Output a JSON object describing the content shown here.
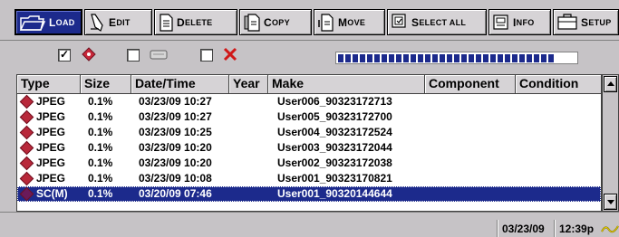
{
  "toolbar": {
    "buttons": [
      {
        "label_big": "L",
        "label": "OAD"
      },
      {
        "label_big": "E",
        "label": "DIT"
      },
      {
        "label_big": "D",
        "label": "ELETE"
      },
      {
        "label_big": "C",
        "label": "OPY"
      },
      {
        "label_big": "M",
        "label": "OVE"
      },
      {
        "label_big": "S",
        "label": "ELECT ALL"
      },
      {
        "label_big": "I",
        "label": "NFO"
      },
      {
        "label_big": "S",
        "label": "ETUP"
      }
    ]
  },
  "filters": {
    "checks": [
      "✓",
      "",
      ""
    ],
    "progress_segments": 30
  },
  "table": {
    "columns": [
      "Type",
      "Size",
      "Date/Time",
      "Year",
      "Make",
      "Component",
      "Condition"
    ],
    "rows": [
      {
        "type": "JPEG",
        "size": "0.1%",
        "datetime": "03/23/09 10:27",
        "year": "",
        "make": "User006_90323172713",
        "component": "",
        "condition": ""
      },
      {
        "type": "JPEG",
        "size": "0.1%",
        "datetime": "03/23/09 10:27",
        "year": "",
        "make": "User005_90323172700",
        "component": "",
        "condition": ""
      },
      {
        "type": "JPEG",
        "size": "0.1%",
        "datetime": "03/23/09 10:25",
        "year": "",
        "make": "User004_90323172524",
        "component": "",
        "condition": ""
      },
      {
        "type": "JPEG",
        "size": "0.1%",
        "datetime": "03/23/09 10:20",
        "year": "",
        "make": "User003_90323172044",
        "component": "",
        "condition": ""
      },
      {
        "type": "JPEG",
        "size": "0.1%",
        "datetime": "03/23/09 10:20",
        "year": "",
        "make": "User002_90323172038",
        "component": "",
        "condition": ""
      },
      {
        "type": "JPEG",
        "size": "0.1%",
        "datetime": "03/23/09 10:08",
        "year": "",
        "make": "User001_90323170821",
        "component": "",
        "condition": ""
      },
      {
        "type": "SC(M)",
        "size": "0.1%",
        "datetime": "03/20/09 07:46",
        "year": "",
        "make": "User001_90320144644",
        "component": "",
        "condition": ""
      }
    ]
  },
  "status": {
    "date": "03/23/09",
    "time": "12:39p"
  },
  "colors": {
    "accent": "#1c2a8c",
    "file_icon": "#b8283a"
  }
}
